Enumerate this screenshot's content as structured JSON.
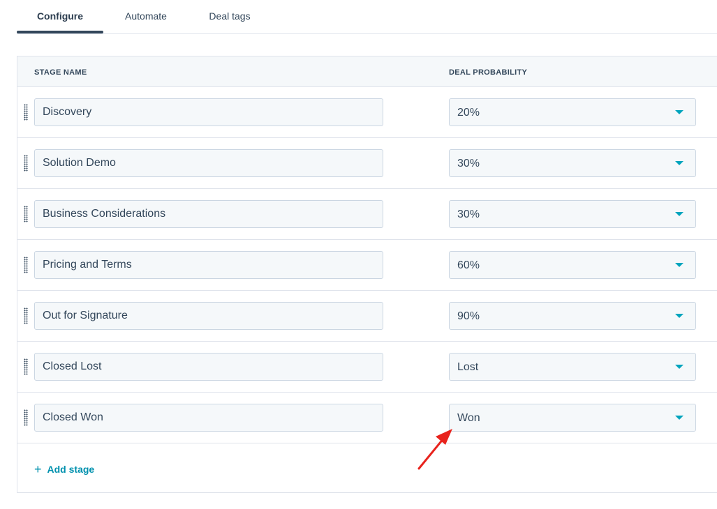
{
  "tabs": [
    {
      "label": "Configure",
      "active": true
    },
    {
      "label": "Automate",
      "active": false
    },
    {
      "label": "Deal tags",
      "active": false
    }
  ],
  "table": {
    "headers": {
      "stage_name": "STAGE NAME",
      "deal_probability": "DEAL PROBABILITY"
    },
    "rows": [
      {
        "stage": "Discovery",
        "probability": "20%"
      },
      {
        "stage": "Solution Demo",
        "probability": "30%"
      },
      {
        "stage": "Business Considerations",
        "probability": "30%"
      },
      {
        "stage": "Pricing and Terms",
        "probability": "60%"
      },
      {
        "stage": "Out for Signature",
        "probability": "90%"
      },
      {
        "stage": "Closed Lost",
        "probability": "Lost"
      },
      {
        "stage": "Closed Won",
        "probability": "Won"
      }
    ],
    "add_stage_label": "Add stage"
  },
  "icons": {
    "drag_handle": "drag-handle-icon",
    "dropdown_caret": "chevron-down-icon",
    "plus": "plus-icon",
    "annotation_arrow": "annotation-arrow-icon"
  },
  "colors": {
    "accent": "#0091ae",
    "caret": "#00a4bd",
    "text": "#33475b",
    "border": "#dfe3eb",
    "input_bg": "#f5f8fa",
    "annotation": "#e8231d"
  }
}
